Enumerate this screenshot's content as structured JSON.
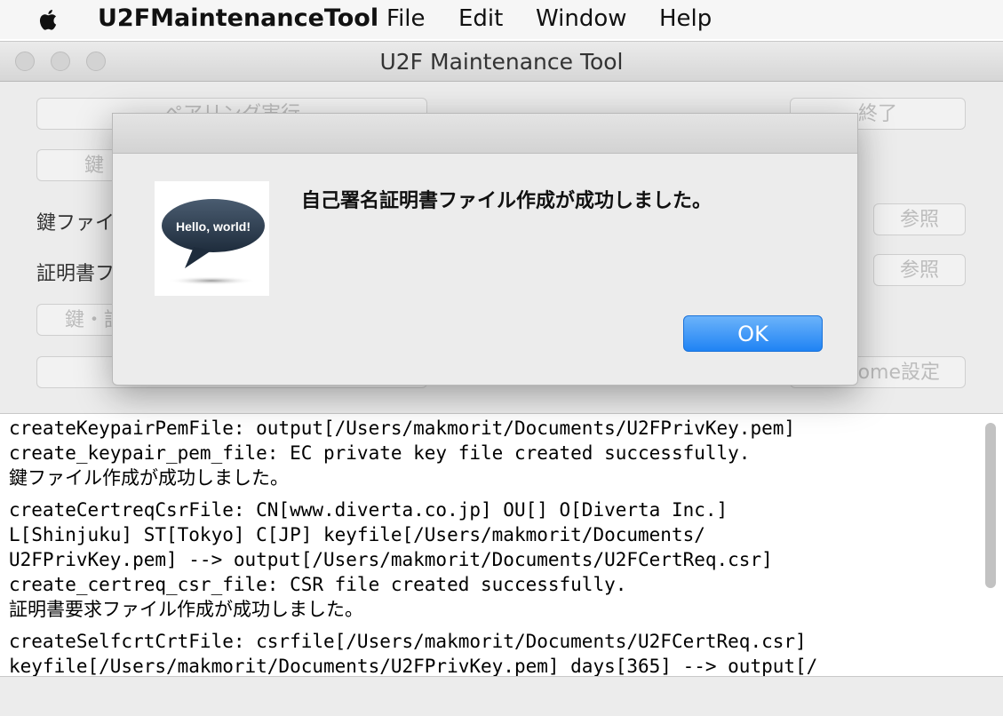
{
  "menubar": {
    "app_name": "U2FMaintenanceTool",
    "items": [
      "File",
      "Edit",
      "Window",
      "Help"
    ]
  },
  "window": {
    "title": "U2F Maintenance Tool",
    "buttons": {
      "pairing": "ペアリング実行",
      "quit": "終了",
      "key_btn": "鍵",
      "browse1": "参照",
      "browse2": "参照",
      "key_cert": "鍵・証",
      "chrome_settings": "ome設定"
    },
    "labels": {
      "key_file": "鍵ファイ",
      "cert_file": "証明書フ"
    }
  },
  "dialog": {
    "icon_text": "Hello, world!",
    "message": "自己署名証明書ファイル作成が成功しました。",
    "ok_label": "OK"
  },
  "log": {
    "entries": [
      {
        "lines": [
          "createKeypairPemFile: output[/Users/makmorit/Documents/U2FPrivKey.pem]",
          "create_keypair_pem_file: EC private key file created successfully.",
          "鍵ファイル作成が成功しました。"
        ]
      },
      {
        "lines": [
          "createCertreqCsrFile: CN[www.diverta.co.jp] OU[] O[Diverta Inc.]",
          "L[Shinjuku] ST[Tokyo] C[JP] keyfile[/Users/makmorit/Documents/",
          "U2FPrivKey.pem] --> output[/Users/makmorit/Documents/U2FCertReq.csr]",
          "create_certreq_csr_file: CSR file created successfully.",
          "証明書要求ファイル作成が成功しました。"
        ]
      },
      {
        "lines": [
          "createSelfcrtCrtFile: csrfile[/Users/makmorit/Documents/U2FCertReq.csr]",
          "keyfile[/Users/makmorit/Documents/U2FPrivKey.pem] days[365] --> output[/"
        ]
      }
    ]
  },
  "colors": {
    "accent": "#1f83f4",
    "window_bg": "#ececec"
  }
}
